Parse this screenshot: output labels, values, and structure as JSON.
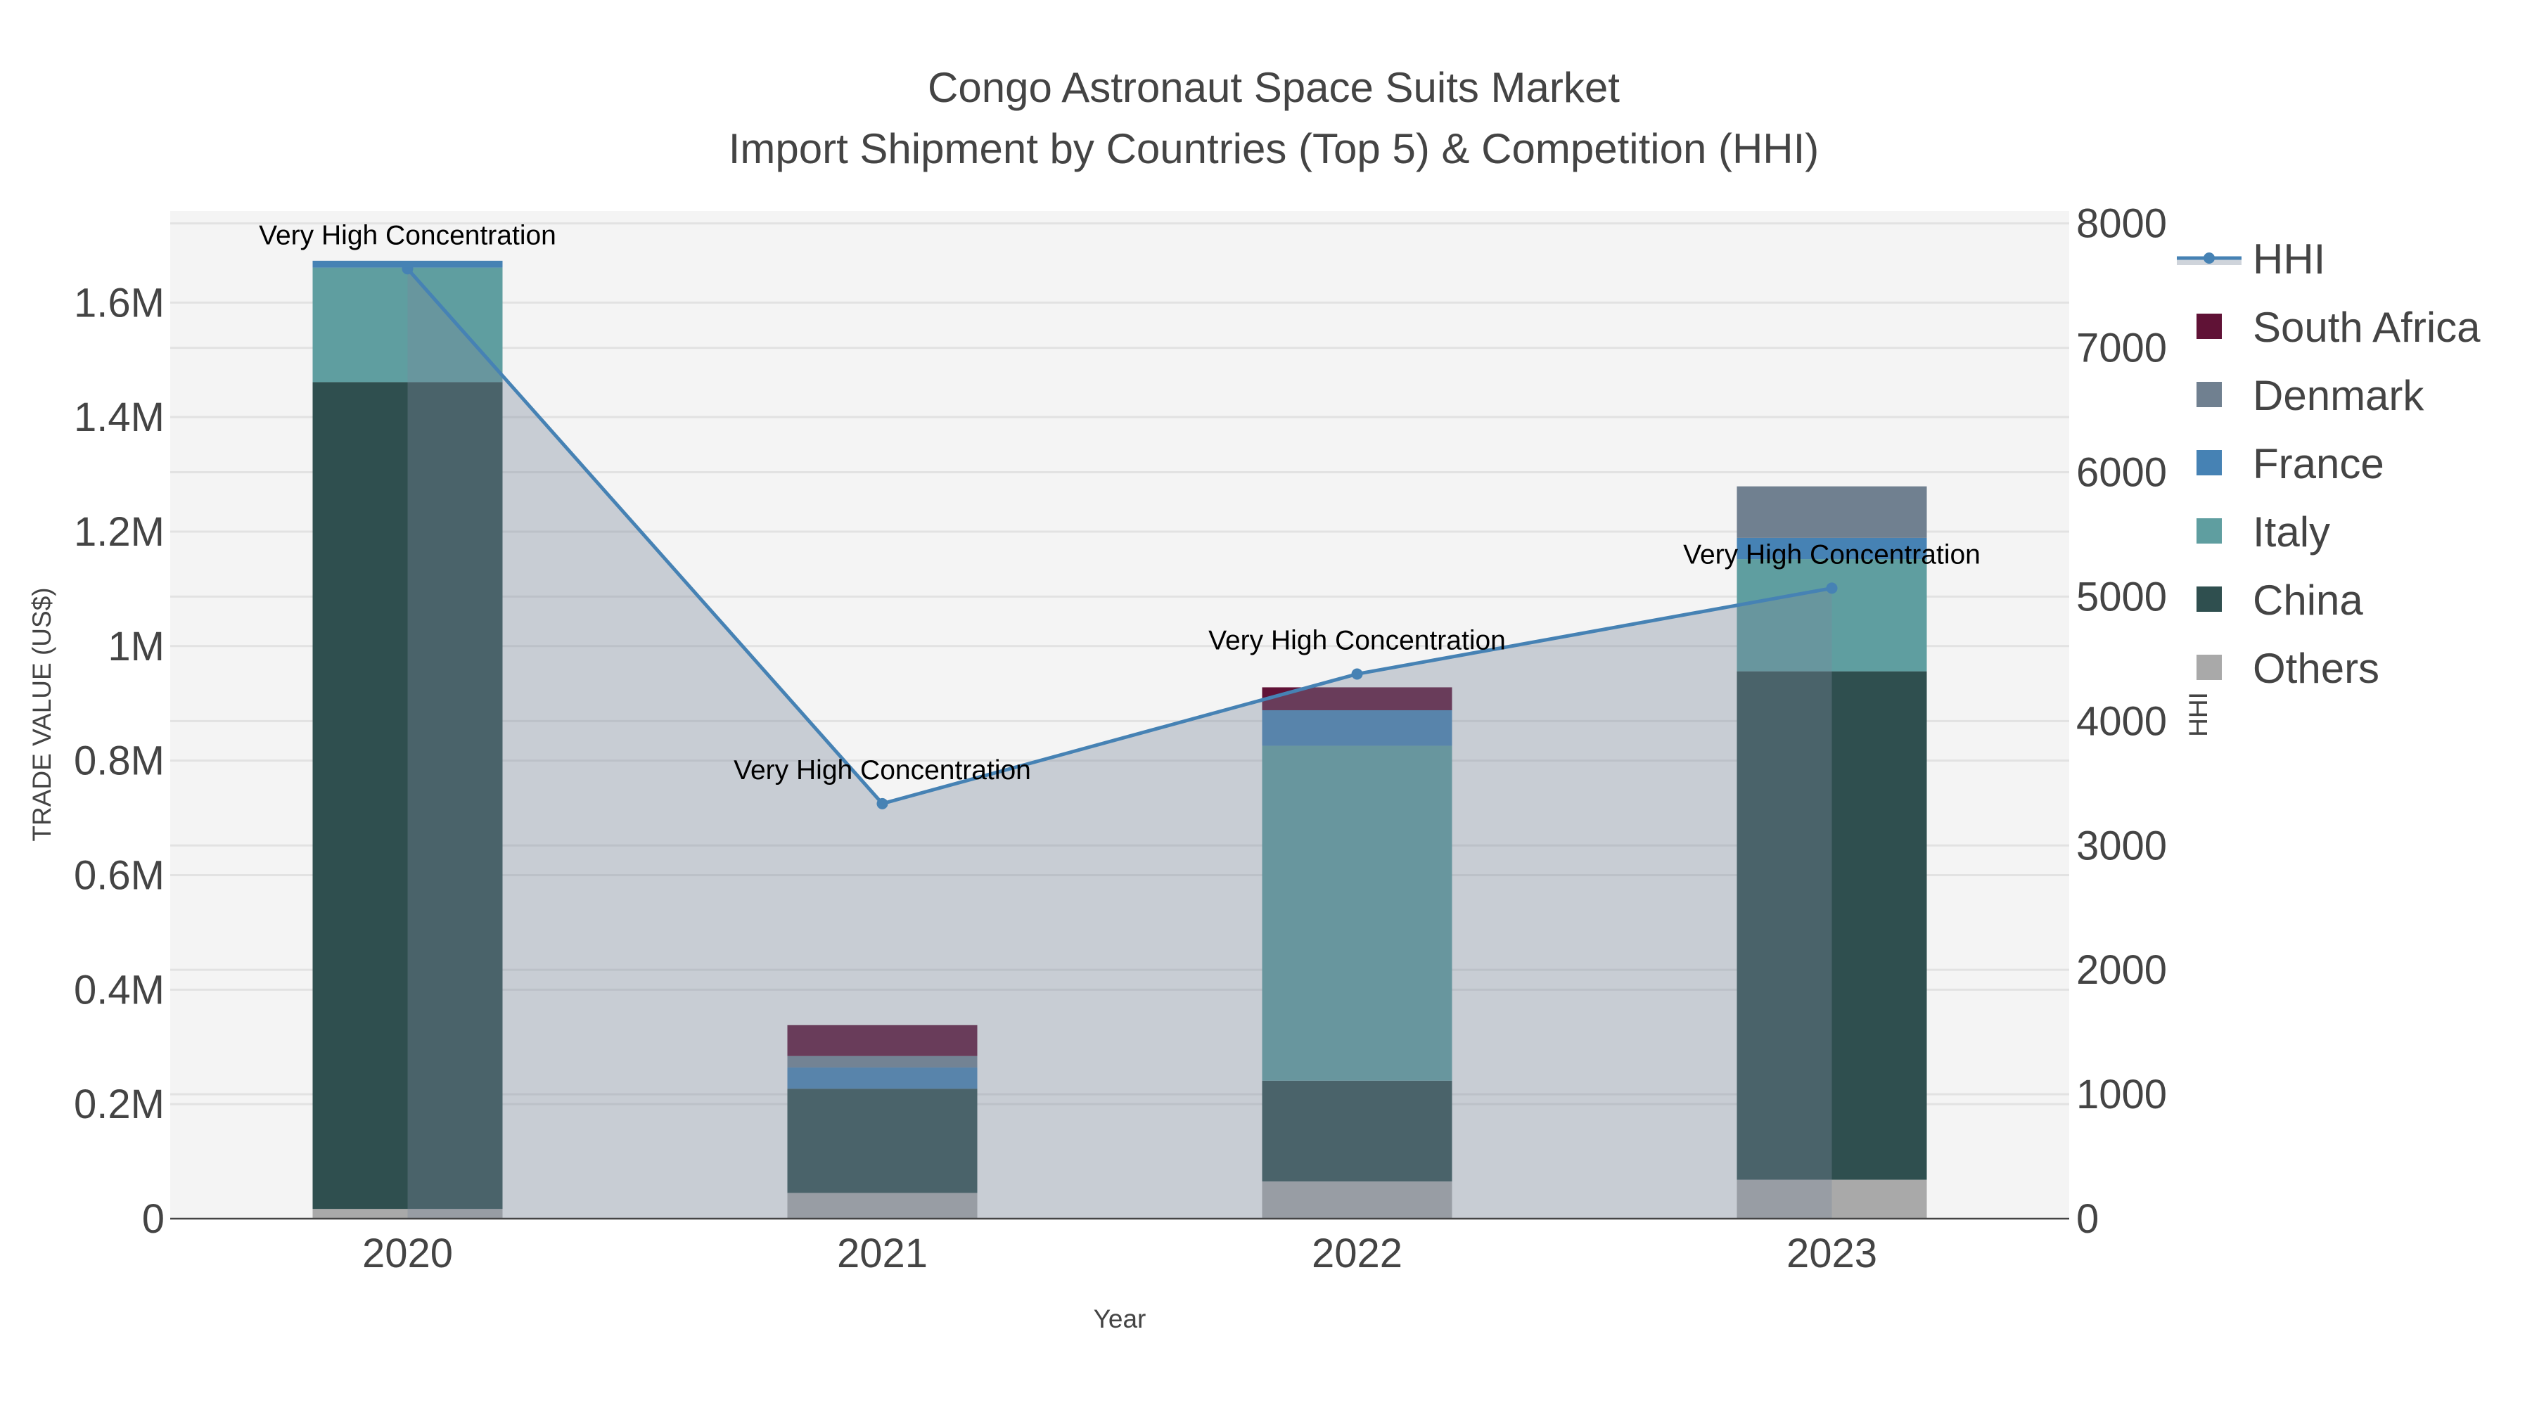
{
  "chart_data": {
    "type": "bar",
    "title_line1": "Congo Astronaut Space Suits Market",
    "title_line2": "Import Shipment by Countries (Top 5) & Competition (HHI)",
    "xlabel": "Year",
    "ylabel": "TRADE VALUE (US$)",
    "y2label": "HHI",
    "categories": [
      "2020",
      "2021",
      "2022",
      "2023"
    ],
    "ylim": [
      0,
      1760000
    ],
    "y2lim": [
      0,
      8100
    ],
    "yticks": [
      0,
      200000,
      400000,
      600000,
      800000,
      1000000,
      1200000,
      1400000,
      1600000
    ],
    "ytick_labels": [
      "0",
      "0.2M",
      "0.4M",
      "0.6M",
      "0.8M",
      "1M",
      "1.2M",
      "1.4M",
      "1.6M"
    ],
    "y2ticks": [
      0,
      1000,
      2000,
      3000,
      4000,
      5000,
      6000,
      7000,
      8000
    ],
    "y2tick_labels": [
      "0",
      "1000",
      "2000",
      "3000",
      "4000",
      "5000",
      "6000",
      "7000",
      "8000"
    ],
    "stacked": true,
    "series": [
      {
        "name": "Others",
        "color": "#A9A9A9",
        "values": [
          17000,
          45000,
          65000,
          68000
        ]
      },
      {
        "name": "China",
        "color": "#2F4F4F",
        "values": [
          1444000,
          182000,
          176000,
          888000
        ]
      },
      {
        "name": "Italy",
        "color": "#5F9EA0",
        "values": [
          200000,
          0,
          585000,
          196000
        ]
      },
      {
        "name": "France",
        "color": "#4682B4",
        "values": [
          12000,
          37000,
          62000,
          37000
        ]
      },
      {
        "name": "Denmark",
        "color": "#708090",
        "values": [
          0,
          20000,
          0,
          90000
        ]
      },
      {
        "name": "South Africa",
        "color": "#601236",
        "values": [
          0,
          54000,
          40000,
          0
        ]
      }
    ],
    "hhi": {
      "name": "HHI",
      "color": "#4682B4",
      "values": [
        7635,
        3336,
        4378,
        5068
      ],
      "annotations": [
        "Very High Concentration",
        "Very High Concentration",
        "Very High Concentration",
        "Very High Concentration"
      ]
    },
    "legend_order": [
      "HHI",
      "South Africa",
      "Denmark",
      "France",
      "Italy",
      "China",
      "Others"
    ],
    "legend_placement": "right",
    "grid": true
  }
}
